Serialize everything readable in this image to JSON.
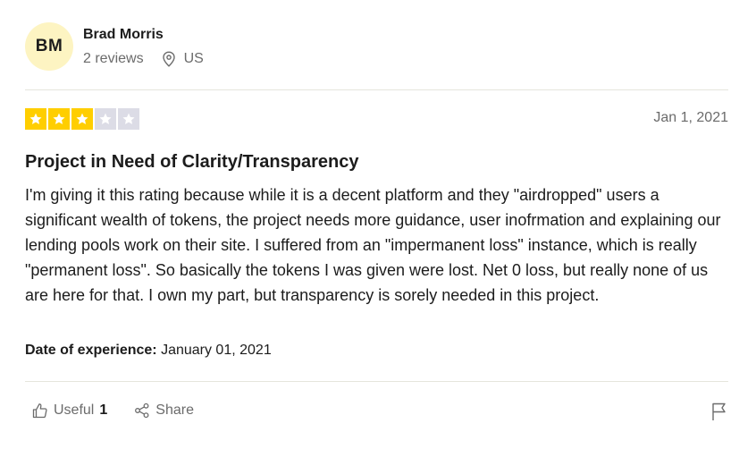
{
  "reviewer": {
    "initials": "BM",
    "name": "Brad Morris",
    "reviews": "2 reviews",
    "location": "US",
    "avatar_color": "#fdf4c2"
  },
  "review": {
    "rating": 3,
    "max_rating": 5,
    "star_color": "#ffce00",
    "star_empty_color": "#dcdce6",
    "date": "Jan 1, 2021",
    "title": "Project in Need of Clarity/Transparency",
    "body": "I'm giving it this rating because while it is a decent platform and they \"airdropped\" users a significant wealth of tokens, the project needs more guidance, user inofrmation and explaining our lending pools work on their site. I suffered from an \"impermanent loss\" instance, which is really \"permanent loss\". So basically the tokens I was given were lost. Net 0 loss, but really none of us are here for that. I own my part, but transparency is sorely needed in this project.",
    "date_of_experience_label": "Date of experience:",
    "date_of_experience": "January 01, 2021"
  },
  "actions": {
    "useful_label": "Useful",
    "useful_count": "1",
    "share_label": "Share"
  },
  "icons": {
    "location": "location-pin-icon",
    "useful": "thumbs-up-icon",
    "share": "share-icon",
    "flag": "flag-icon",
    "star": "star-icon"
  }
}
